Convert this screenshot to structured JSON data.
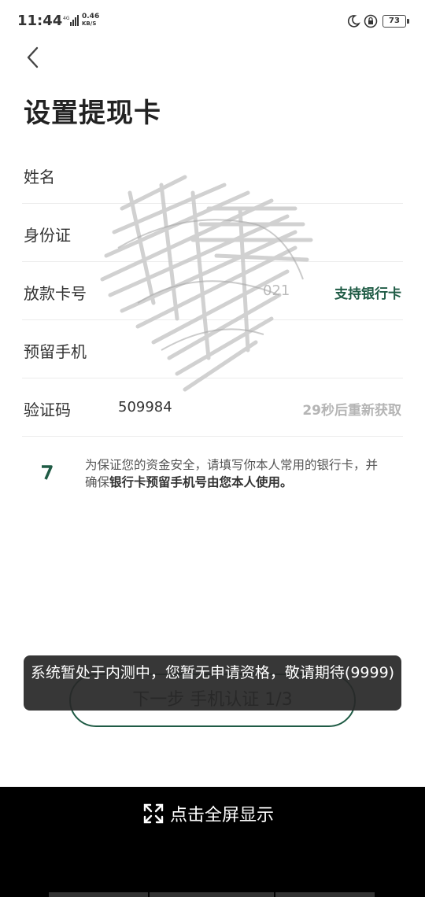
{
  "status_bar": {
    "time": "11:44",
    "network": "4G",
    "speed_value": "0.46",
    "speed_unit": "KB/S",
    "battery": "73"
  },
  "page": {
    "title": "设置提现卡"
  },
  "form": {
    "name": {
      "label": "姓名",
      "value": ""
    },
    "id_card": {
      "label": "身份证",
      "value": ""
    },
    "card_number": {
      "label": "放款卡号",
      "value": "021",
      "action": "支持银行卡"
    },
    "phone": {
      "label": "预留手机",
      "value": ""
    },
    "code": {
      "label": "验证码",
      "value": "509984",
      "action": "29秒后重新获取"
    }
  },
  "notice": {
    "text_1": "为保证您的资金安全，请填写你本人常用的银行卡，并确保",
    "text_bold": "银行卡预留手机号由您本人使用。"
  },
  "next_button": {
    "label": "下一步 手机认证 1/3"
  },
  "toast": {
    "text": "系统暂处于内测中，您暂无申请资格，敬请期待(9999)"
  },
  "bottom_bar": {
    "label": "点击全屏显示"
  },
  "colors": {
    "accent": "#1f5b45",
    "toast_bg": "#282828",
    "muted": "#b5b5b5"
  }
}
